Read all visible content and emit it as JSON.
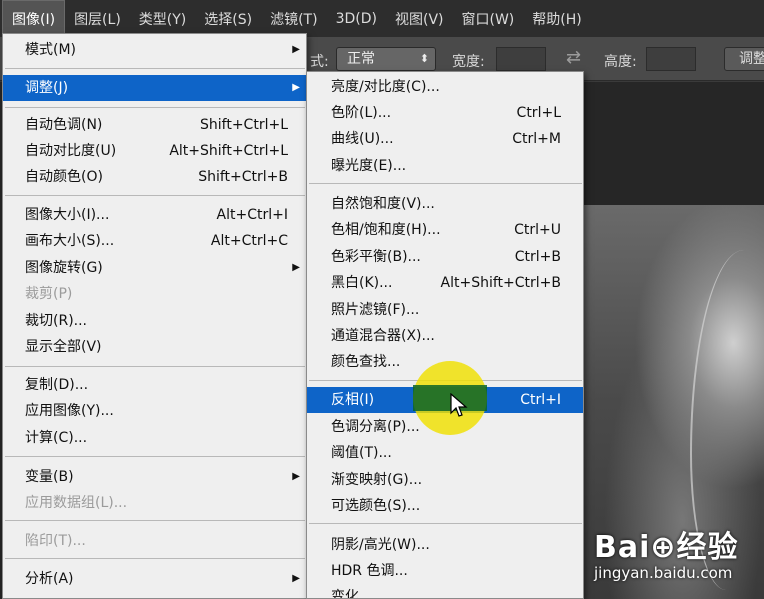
{
  "menubar": {
    "items": [
      "图像(I)",
      "图层(L)",
      "类型(Y)",
      "选择(S)",
      "滤镜(T)",
      "3D(D)",
      "视图(V)",
      "窗口(W)",
      "帮助(H)"
    ]
  },
  "options_bar": {
    "style_label": "式:",
    "style_value": "正常",
    "width_label": "宽度:",
    "height_label": "高度:",
    "adjust_button": "调整"
  },
  "image_menu": {
    "mode": "模式(M)",
    "adjust": "调整(J)",
    "auto_tone": "自动色调(N)",
    "auto_tone_sc": "Shift+Ctrl+L",
    "auto_contrast": "自动对比度(U)",
    "auto_contrast_sc": "Alt+Shift+Ctrl+L",
    "auto_color": "自动颜色(O)",
    "auto_color_sc": "Shift+Ctrl+B",
    "image_size": "图像大小(I)...",
    "image_size_sc": "Alt+Ctrl+I",
    "canvas_size": "画布大小(S)...",
    "canvas_size_sc": "Alt+Ctrl+C",
    "image_rotation": "图像旋转(G)",
    "crop": "裁剪(P)",
    "trim": "裁切(R)...",
    "reveal_all": "显示全部(V)",
    "duplicate": "复制(D)...",
    "apply_image": "应用图像(Y)...",
    "calculations": "计算(C)...",
    "variables": "变量(B)",
    "apply_data_set": "应用数据组(L)...",
    "trap": "陷印(T)...",
    "analysis": "分析(A)"
  },
  "adjust_menu": {
    "brightness": "亮度/对比度(C)...",
    "levels": "色阶(L)...",
    "levels_sc": "Ctrl+L",
    "curves": "曲线(U)...",
    "curves_sc": "Ctrl+M",
    "exposure": "曝光度(E)...",
    "vibrance": "自然饱和度(V)...",
    "hue_sat": "色相/饱和度(H)...",
    "hue_sat_sc": "Ctrl+U",
    "color_balance": "色彩平衡(B)...",
    "color_balance_sc": "Ctrl+B",
    "black_white": "黑白(K)...",
    "black_white_sc": "Alt+Shift+Ctrl+B",
    "photo_filter": "照片滤镜(F)...",
    "channel_mixer": "通道混合器(X)...",
    "color_lookup": "颜色查找...",
    "invert": "反相(I)",
    "invert_sc": "Ctrl+I",
    "posterize": "色调分离(P)...",
    "threshold": "阈值(T)...",
    "gradient_map": "渐变映射(G)...",
    "selective_color": "可选颜色(S)...",
    "shadows_highlights": "阴影/高光(W)...",
    "hdr_toning": "HDR 色调...",
    "variations": "变化"
  },
  "watermark": {
    "logo": "Bai⊕经验",
    "url": "jingyan.baidu.com"
  },
  "colors": {
    "highlight": "#0e64c8",
    "menu_bg": "#efefef",
    "spotlight": "#f0e100"
  }
}
